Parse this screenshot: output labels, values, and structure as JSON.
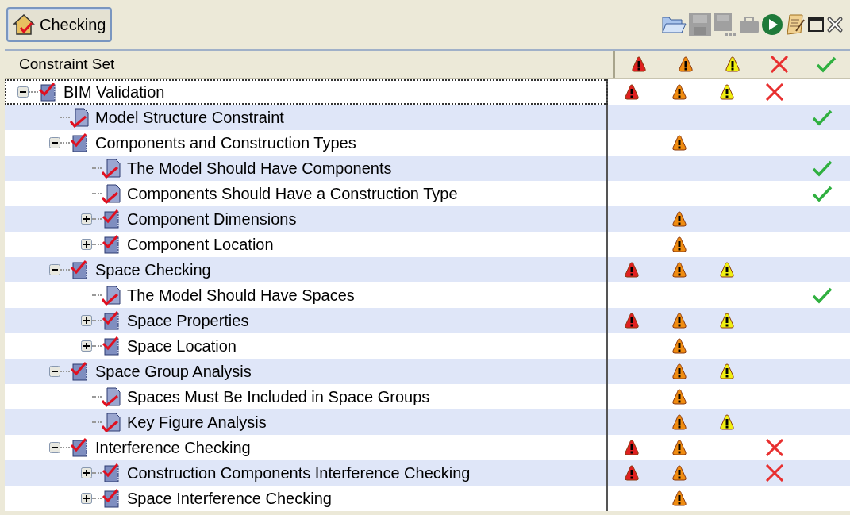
{
  "tab": {
    "label": "Checking",
    "selected": true
  },
  "toolbar": [
    {
      "kind": "open",
      "disabled": false
    },
    {
      "kind": "save",
      "disabled": true
    },
    {
      "kind": "save-all",
      "disabled": true
    },
    {
      "kind": "case",
      "disabled": true
    },
    {
      "kind": "run",
      "disabled": false
    },
    {
      "kind": "report",
      "disabled": false
    },
    {
      "kind": "maximize",
      "disabled": false
    },
    {
      "kind": "close",
      "disabled": false
    }
  ],
  "table": {
    "tree_header": "Constraint Set",
    "result_columns": [
      {
        "kind": "critical"
      },
      {
        "kind": "major"
      },
      {
        "kind": "minor"
      },
      {
        "kind": "failed"
      },
      {
        "kind": "passed"
      }
    ],
    "rows": [
      {
        "label": "BIM Validation",
        "kind": "set",
        "expanded": true,
        "selected": true,
        "critical": true,
        "major": true,
        "minor": true,
        "failed": true,
        "passed": false,
        "children": [
          {
            "label": "Model Structure Constraint",
            "kind": "rule",
            "selected": false,
            "critical": false,
            "major": false,
            "minor": false,
            "failed": false,
            "passed": true
          },
          {
            "label": "Components and Construction Types",
            "kind": "set",
            "expanded": true,
            "selected": false,
            "critical": false,
            "major": true,
            "minor": false,
            "failed": false,
            "passed": false,
            "children": [
              {
                "label": "The Model Should Have Components",
                "kind": "rule",
                "selected": false,
                "critical": false,
                "major": false,
                "minor": false,
                "failed": false,
                "passed": true
              },
              {
                "label": "Components Should Have a Construction Type",
                "kind": "rule",
                "selected": false,
                "critical": false,
                "major": false,
                "minor": false,
                "failed": false,
                "passed": true
              },
              {
                "label": "Component Dimensions",
                "kind": "set",
                "expanded": false,
                "selected": false,
                "critical": false,
                "major": true,
                "minor": false,
                "failed": false,
                "passed": false
              },
              {
                "label": "Component Location",
                "kind": "set",
                "expanded": false,
                "selected": false,
                "critical": false,
                "major": true,
                "minor": false,
                "failed": false,
                "passed": false
              }
            ]
          },
          {
            "label": "Space Checking",
            "kind": "set",
            "expanded": true,
            "selected": false,
            "critical": true,
            "major": true,
            "minor": true,
            "failed": false,
            "passed": false,
            "children": [
              {
                "label": "The Model Should Have Spaces",
                "kind": "rule",
                "selected": false,
                "critical": false,
                "major": false,
                "minor": false,
                "failed": false,
                "passed": true
              },
              {
                "label": "Space Properties",
                "kind": "set",
                "expanded": false,
                "selected": false,
                "critical": true,
                "major": true,
                "minor": true,
                "failed": false,
                "passed": false
              },
              {
                "label": "Space Location",
                "kind": "set",
                "expanded": false,
                "selected": false,
                "critical": false,
                "major": true,
                "minor": false,
                "failed": false,
                "passed": false
              }
            ]
          },
          {
            "label": "Space Group Analysis",
            "kind": "set",
            "expanded": true,
            "selected": false,
            "critical": false,
            "major": true,
            "minor": true,
            "failed": false,
            "passed": false,
            "children": [
              {
                "label": "Spaces Must Be Included in Space Groups",
                "kind": "rule",
                "selected": false,
                "critical": false,
                "major": true,
                "minor": false,
                "failed": false,
                "passed": false
              },
              {
                "label": "Key Figure Analysis",
                "kind": "rule",
                "selected": false,
                "critical": false,
                "major": true,
                "minor": true,
                "failed": false,
                "passed": false
              }
            ]
          },
          {
            "label": "Interference Checking",
            "kind": "set",
            "expanded": true,
            "selected": false,
            "critical": true,
            "major": true,
            "minor": false,
            "failed": true,
            "passed": false,
            "children": [
              {
                "label": "Construction Components Interference Checking",
                "kind": "set",
                "expanded": false,
                "selected": false,
                "critical": true,
                "major": true,
                "minor": false,
                "failed": true,
                "passed": false
              },
              {
                "label": "Space Interference Checking",
                "kind": "set",
                "expanded": false,
                "selected": false,
                "critical": false,
                "major": true,
                "minor": false,
                "failed": false,
                "passed": false
              }
            ]
          }
        ]
      }
    ]
  }
}
